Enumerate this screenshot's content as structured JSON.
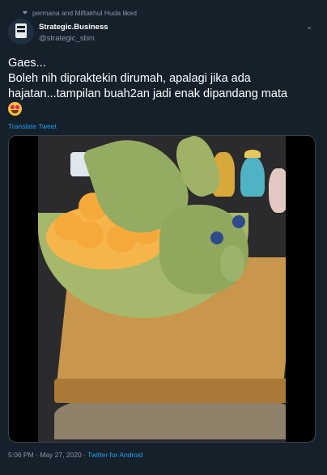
{
  "social_context": {
    "text": "permana and Miftakhul Huda liked",
    "icon": "heart-icon"
  },
  "author": {
    "display_name": "Strategic.Business",
    "handle": "@strategic_sbm",
    "avatar_icon": "sbm-logo-icon"
  },
  "tweet": {
    "lines": [
      "Gaes...",
      "Boleh nih dipraktekin dirumah, apalagi jika ada",
      "hajatan...tampilan buah2an jadi enak dipandang mata"
    ],
    "emoji": "heart-eyes-emoji"
  },
  "translate_label": "Translate Tweet",
  "media": {
    "type": "video",
    "description_icon": "video-thumbnail"
  },
  "meta": {
    "time": "5:06 PM · May 27, 2020 · ",
    "source": "Twitter for Android"
  },
  "colors": {
    "background": "#15202b",
    "accent": "#1da1f2",
    "secondary": "#8899a6"
  }
}
